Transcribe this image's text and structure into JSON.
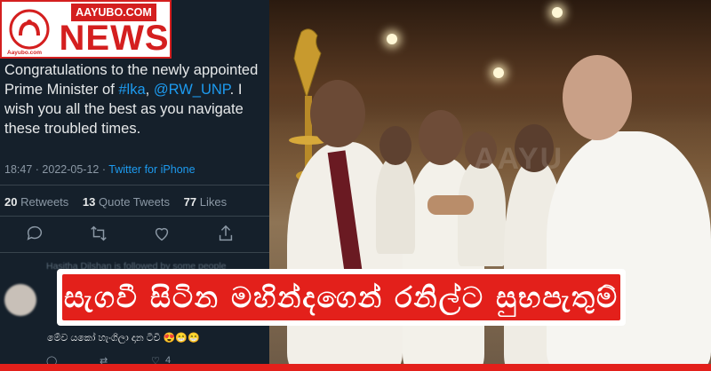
{
  "header": {
    "site_name": "AAYUBO.COM",
    "section": "NEWS",
    "logo_caption": "Aayubo.com"
  },
  "tweet": {
    "text_1": "Congratulations to the newly appointed Prime Minister of ",
    "hashtag": "#lka",
    "text_2": ",",
    "mention": "@RW_UNP",
    "text_3": ". I wish you all the best as you navigate these troubled times.",
    "time": "18:47",
    "date": "2022-05-12",
    "source": "Twitter for iPhone",
    "retweets_count": "20",
    "retweets_label": "Retweets",
    "quotes_count": "13",
    "quotes_label": "Quote Tweets",
    "likes_count": "77",
    "likes_label": "Likes"
  },
  "reply": {
    "notice": "Hasitha Dilshan is followed by some people",
    "body": "මේව යකෝ හැංගිලා දාන ටීවී 😍😁😁",
    "like_count": "4"
  },
  "photo": {
    "watermark": "AAYU"
  },
  "headline": {
    "text": "සැගවී සිටින මහින්දගෙන් රනිල්ට සුභපැතුම්"
  },
  "colors": {
    "brand_red": "#e3201b",
    "twitter_blue": "#1d9bf0",
    "dark_bg": "#15202b"
  }
}
